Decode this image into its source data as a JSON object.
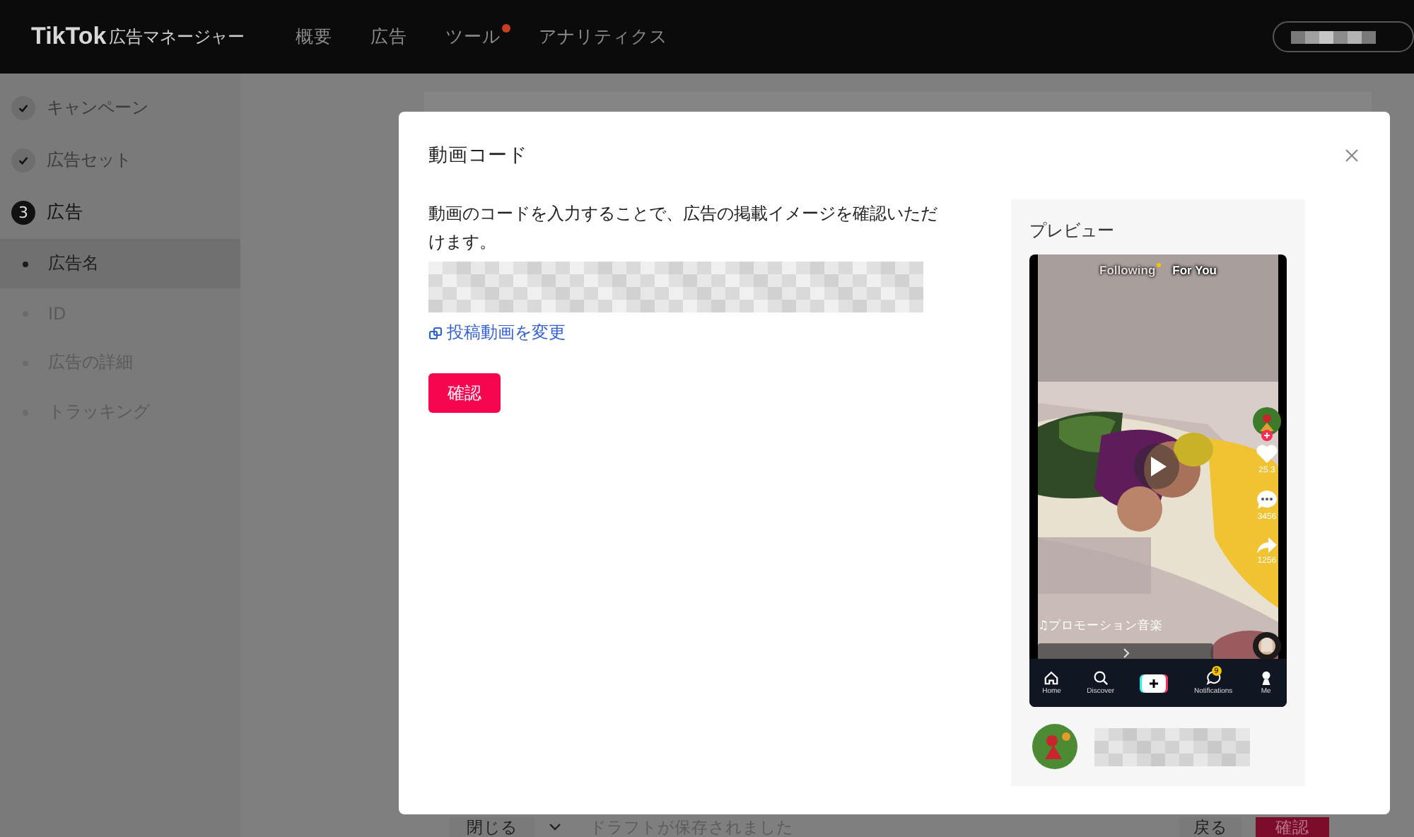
{
  "header": {
    "logo": "TikTok",
    "logo_suffix": "広告マネージャー",
    "nav": [
      {
        "label": "概要",
        "badge": false
      },
      {
        "label": "広告",
        "badge": false
      },
      {
        "label": "ツール",
        "badge": true
      },
      {
        "label": "アナリティクス",
        "badge": false
      }
    ]
  },
  "sidebar": {
    "steps": [
      {
        "label": "キャンペーン",
        "kind": "done"
      },
      {
        "label": "広告セット",
        "kind": "done"
      },
      {
        "label": "広告",
        "kind": "current",
        "number": "3"
      }
    ],
    "sub_items": [
      {
        "label": "広告名",
        "selected": true
      },
      {
        "label": "ID",
        "selected": false
      },
      {
        "label": "広告の詳細",
        "selected": false
      },
      {
        "label": "トラッキング",
        "selected": false
      }
    ]
  },
  "footer": {
    "close": "閉じる",
    "status": "ドラフトが保存されました",
    "back": "戻る",
    "confirm": "確認"
  },
  "modal": {
    "title": "動画コード",
    "description": "動画のコードを入力することで、広告の掲載イメージを確認いただけます。",
    "change_link": "投稿動画を変更",
    "confirm": "確認",
    "preview": {
      "title": "プレビュー",
      "tabs": [
        {
          "label": "Following",
          "selected": false
        },
        {
          "label": "For You",
          "selected": true
        }
      ],
      "likes": "25.3",
      "comments": "3456",
      "shares": "1256",
      "music": "♫プロモーション音楽",
      "nav": [
        {
          "kind": "home",
          "label": "Home"
        },
        {
          "kind": "discover",
          "label": "Discover"
        },
        {
          "kind": "create"
        },
        {
          "kind": "notifications",
          "label": "Notifications",
          "badge": "9"
        },
        {
          "kind": "me",
          "label": "Me"
        }
      ]
    }
  }
}
